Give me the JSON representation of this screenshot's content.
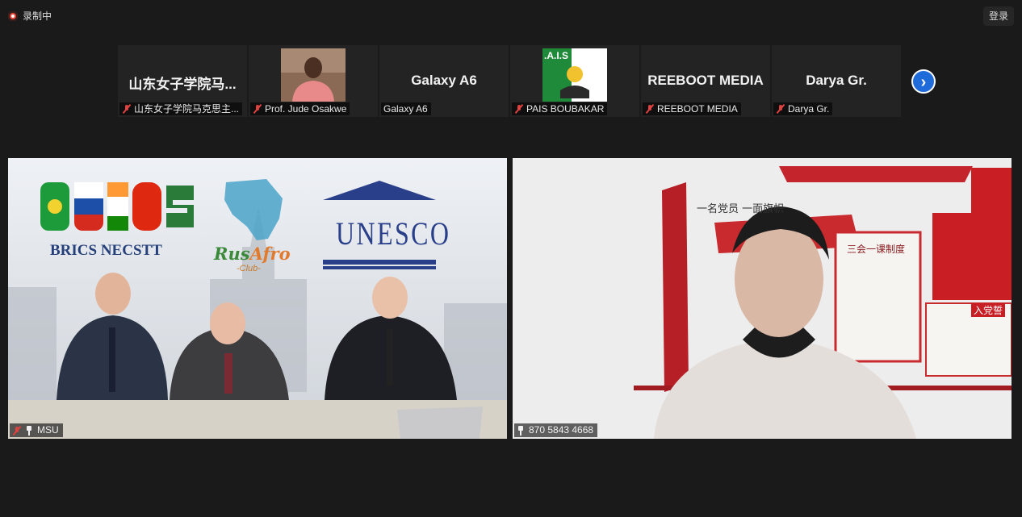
{
  "recording": {
    "label": "录制中"
  },
  "header": {
    "login_label": "登录"
  },
  "participants": [
    {
      "display_name": "山东女子学院马...",
      "caption": "山东女子学院马克思主...",
      "muted": true
    },
    {
      "display_name": "",
      "caption": "Prof. Jude Osakwe",
      "muted": true
    },
    {
      "display_name": "Galaxy A6",
      "caption": "Galaxy A6",
      "muted": false
    },
    {
      "display_name": "",
      "caption": "PAIS BOUBAKAR",
      "muted": true,
      "logo_text": ".A.I.S"
    },
    {
      "display_name": "REEBOOT MEDIA",
      "caption": "REEBOOT MEDIA",
      "muted": true
    },
    {
      "display_name": "Darya Gr.",
      "caption": "Darya Gr.",
      "muted": true
    }
  ],
  "next_page_icon": "chevron-right-icon",
  "main_videos": {
    "left": {
      "caption": "MSU",
      "muted": true,
      "pinned": true,
      "logos": {
        "brics": "BRICS NECSTT",
        "rusafro_rus": "Rus",
        "rusafro_afro": "Afro",
        "rusafro_club": "-Club-",
        "unesco": "UNESCO"
      }
    },
    "right": {
      "caption": "870 5843 4668",
      "pinned": true,
      "wall_text": {
        "slogan": "一名党员 一面旗帜",
        "board_title": "三会一课制度",
        "corner": "入党誓"
      }
    }
  },
  "colors": {
    "background": "#1a1a1a",
    "tile": "#232323",
    "accent": "#1f6bd9",
    "mute": "#e04141"
  }
}
